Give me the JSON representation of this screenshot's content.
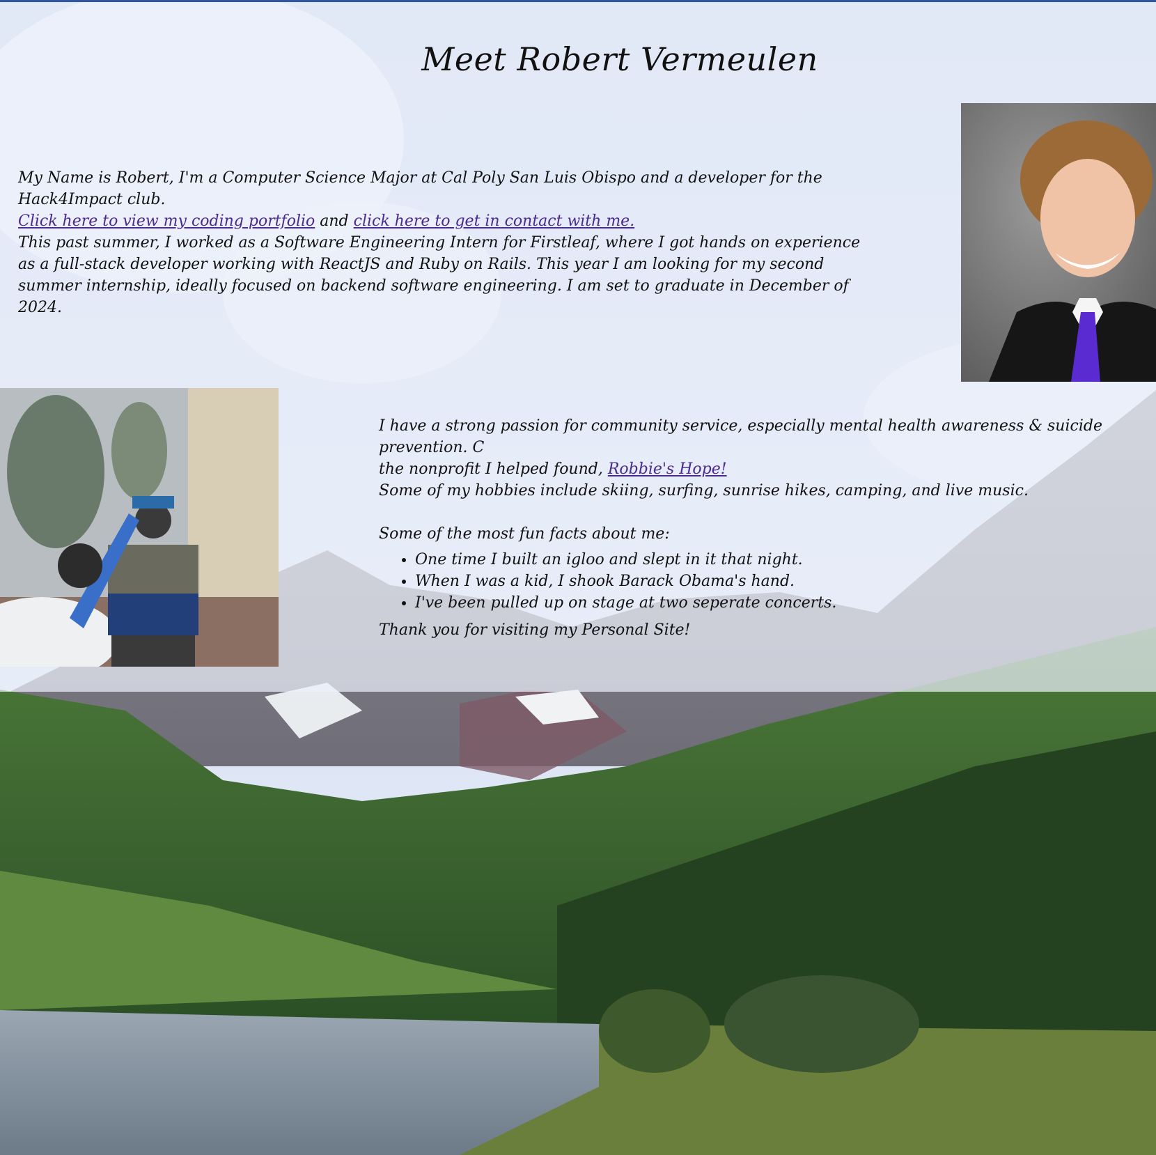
{
  "page": {
    "title": "Meet Robert Vermeulen"
  },
  "intro": {
    "line1": "My Name is Robert, I'm a Computer Science Major at Cal Poly San Luis Obispo and a developer for the Hack4Impact club.",
    "portfolio_link": "Click here to view my coding portfolio",
    "and_text": " and ",
    "contact_link": "click here to get in contact with me.",
    "internship": "This past summer, I worked as a Software Engineering Intern for Firstleaf, where I got hands on experience as a full-stack developer working with ReactJS and Ruby on Rails. This year I am looking for my second summer internship, ideally focused on backend software engineering. I am set to graduate in December of 2024."
  },
  "about": {
    "passion": "I have a strong passion for community service, especially mental health awareness & suicide prevention. Check out the nonprofit I helped found, ",
    "passion_visible_a": "I have a strong passion for community service, especially mental health awareness & suicide prevention. C",
    "passion_visible_b": "the nonprofit I helped found, ",
    "nonprofit_link": "Robbie's Hope!",
    "hobbies": "Some of my hobbies include skiing, surfing, sunrise hikes, camping, and live music.",
    "fun_facts_heading": "Some of the most fun facts about me:",
    "fun_facts": [
      "One time I built an igloo and slept in it that night.",
      "When I was a kid, I shook Barack Obama's hand.",
      "I've been pulled up on stage at two seperate concerts."
    ],
    "thanks": "Thank you for visiting my Personal Site!"
  },
  "colors": {
    "accent_bar": "#2f55a4",
    "link": "#4b2a8f",
    "overlay": "rgba(235,240,250,0.72)"
  }
}
